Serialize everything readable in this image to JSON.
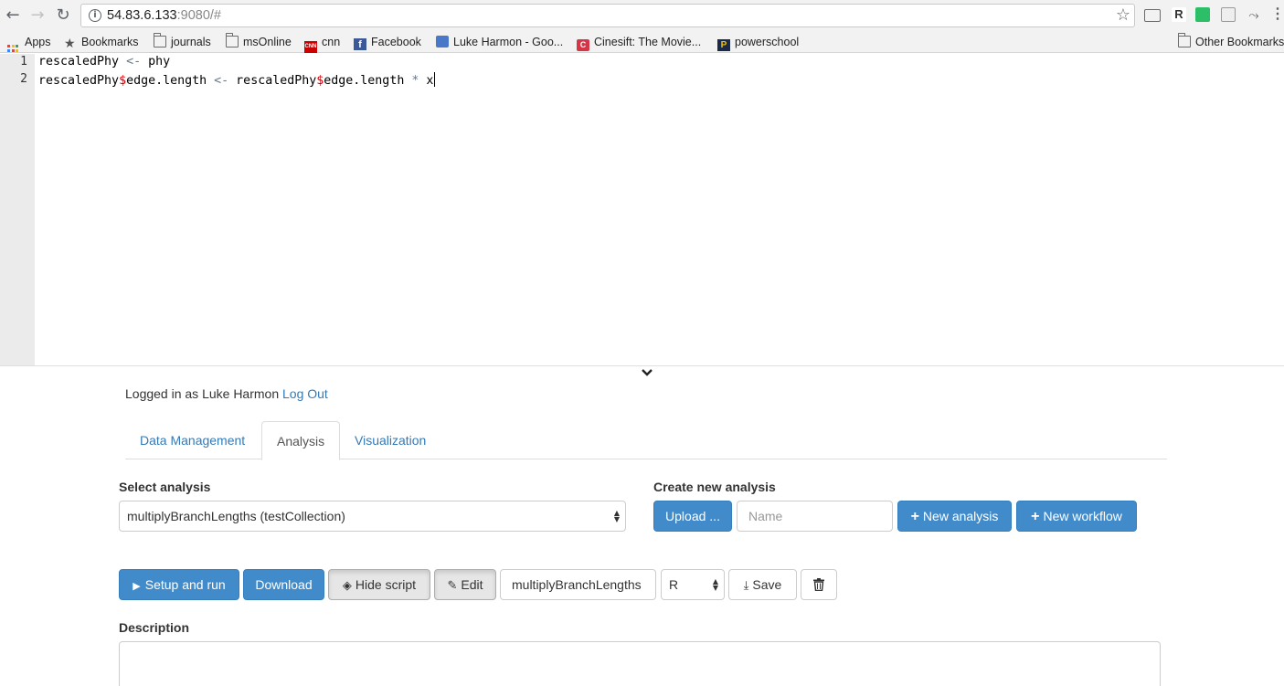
{
  "browser": {
    "url_host": "54.83.6.133",
    "url_rest": ":9080/#",
    "bookmarks": [
      {
        "label": "Apps",
        "icon": "apps-icon"
      },
      {
        "label": "Bookmarks",
        "icon": "star-icon"
      },
      {
        "label": "journals",
        "icon": "folder-icon"
      },
      {
        "label": "msOnline",
        "icon": "folder-icon"
      },
      {
        "label": "cnn",
        "icon": "cnn-icon"
      },
      {
        "label": "Facebook",
        "icon": "facebook-icon"
      },
      {
        "label": "Luke Harmon - Goo...",
        "icon": "google-scholar-icon"
      },
      {
        "label": "Cinesift: The Movie...",
        "icon": "cinesift-icon"
      },
      {
        "label": "powerschool",
        "icon": "powerschool-icon"
      },
      {
        "label": "Other Bookmarks",
        "icon": "folder-icon"
      }
    ]
  },
  "editor": {
    "line_numbers": [
      "1",
      "2"
    ],
    "line1": {
      "a": "rescaledPhy ",
      "op": "<-",
      "b": " phy"
    },
    "line2": {
      "a": "rescaledPhy",
      "d1": "$",
      "b": "edge.length ",
      "op": "<-",
      "c": " rescaledPhy",
      "d2": "$",
      "e": "edge.length ",
      "op2": "*",
      "f": " x"
    }
  },
  "login": {
    "text": "Logged in as Luke Harmon",
    "logout": "Log Out"
  },
  "tabs": [
    "Data Management",
    "Analysis",
    "Visualization"
  ],
  "active_tab": "Analysis",
  "select_analysis": {
    "label": "Select analysis",
    "value": "multiplyBranchLengths (testCollection)"
  },
  "create_analysis": {
    "label": "Create new analysis",
    "upload": "Upload ...",
    "name_placeholder": "Name",
    "new_analysis": "New analysis",
    "new_workflow": "New workflow"
  },
  "actions": {
    "setup_run": "Setup and run",
    "download": "Download",
    "hide_script": "Hide script",
    "edit": "Edit",
    "name_value": "multiplyBranchLengths",
    "language": "R",
    "save": "Save"
  },
  "description": {
    "label": "Description"
  },
  "colors": {
    "primary": "#428bca",
    "link": "#337ab7",
    "dollar": "#c5060b"
  }
}
